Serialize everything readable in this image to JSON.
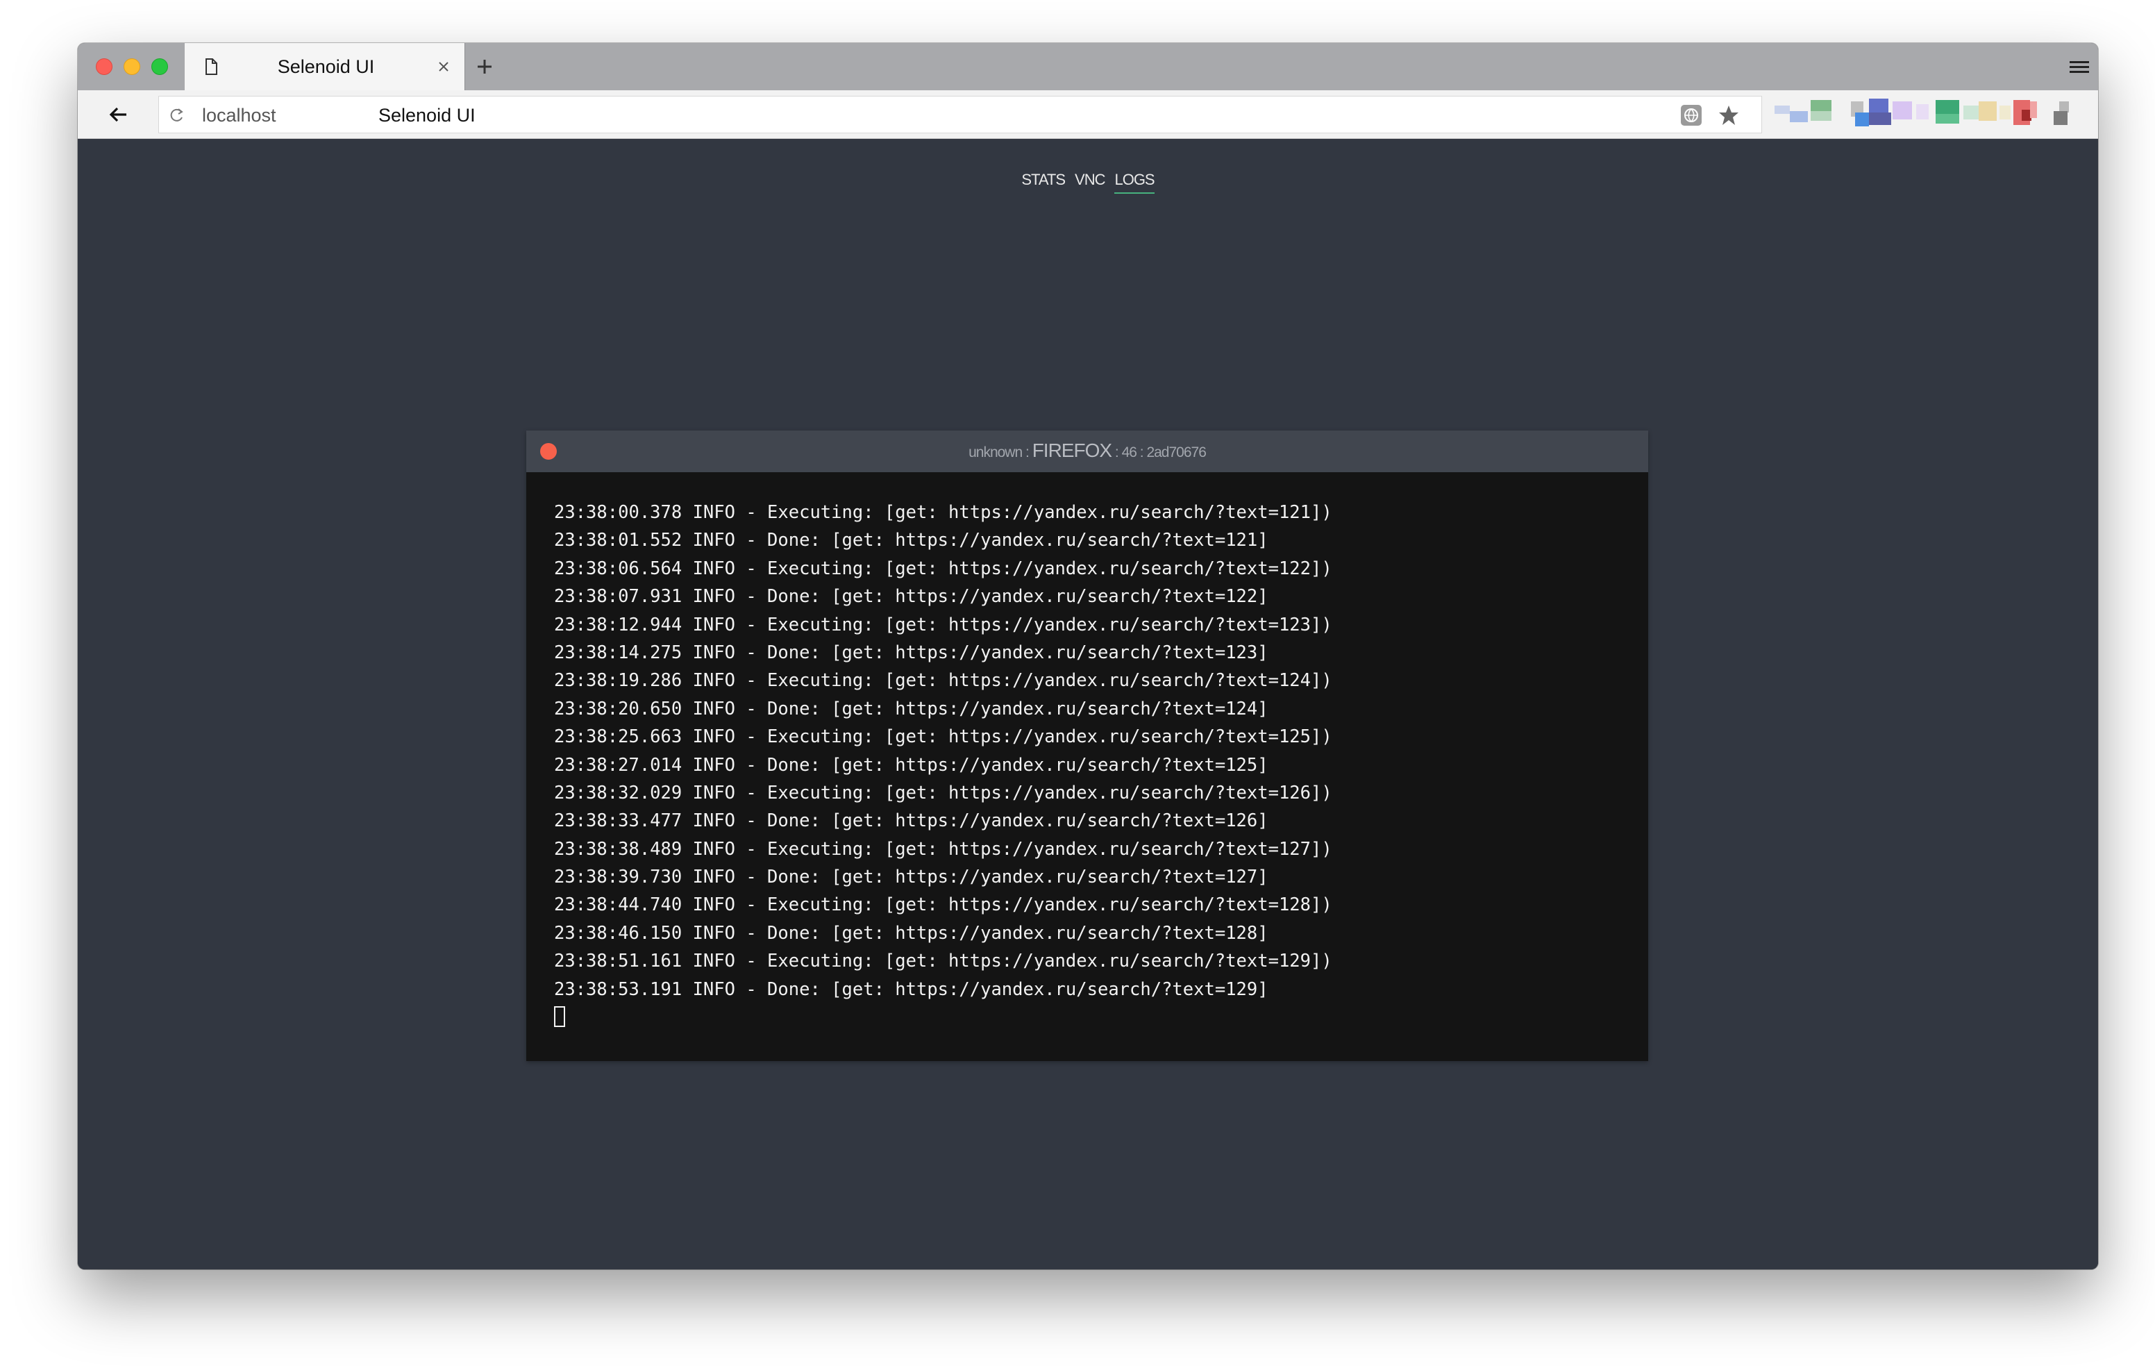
{
  "browser": {
    "tab_title": "Selenoid UI",
    "url_host": "localhost",
    "page_title": "Selenoid UI"
  },
  "nav": {
    "items": [
      "STATS",
      "VNC",
      "LOGS"
    ],
    "active": "LOGS",
    "active_color": "#47b27e"
  },
  "console": {
    "header": {
      "name": "unknown",
      "separator": ":",
      "browser": "FIREFOX",
      "version": "46",
      "session_id": "2ad70676"
    },
    "close_color": "#f7614b",
    "lines": [
      "23:38:00.378 INFO - Executing: [get: https://yandex.ru/search/?text=121])",
      "23:38:01.552 INFO - Done: [get: https://yandex.ru/search/?text=121]",
      "23:38:06.564 INFO - Executing: [get: https://yandex.ru/search/?text=122])",
      "23:38:07.931 INFO - Done: [get: https://yandex.ru/search/?text=122]",
      "23:38:12.944 INFO - Executing: [get: https://yandex.ru/search/?text=123])",
      "23:38:14.275 INFO - Done: [get: https://yandex.ru/search/?text=123]",
      "23:38:19.286 INFO - Executing: [get: https://yandex.ru/search/?text=124])",
      "23:38:20.650 INFO - Done: [get: https://yandex.ru/search/?text=124]",
      "23:38:25.663 INFO - Executing: [get: https://yandex.ru/search/?text=125])",
      "23:38:27.014 INFO - Done: [get: https://yandex.ru/search/?text=125]",
      "23:38:32.029 INFO - Executing: [get: https://yandex.ru/search/?text=126])",
      "23:38:33.477 INFO - Done: [get: https://yandex.ru/search/?text=126]",
      "23:38:38.489 INFO - Executing: [get: https://yandex.ru/search/?text=127])",
      "23:38:39.730 INFO - Done: [get: https://yandex.ru/search/?text=127]",
      "23:38:44.740 INFO - Executing: [get: https://yandex.ru/search/?text=128])",
      "23:38:46.150 INFO - Done: [get: https://yandex.ru/search/?text=128]",
      "23:38:51.161 INFO - Executing: [get: https://yandex.ru/search/?text=129])",
      "23:38:53.191 INFO - Done: [get: https://yandex.ru/search/?text=129]"
    ]
  }
}
